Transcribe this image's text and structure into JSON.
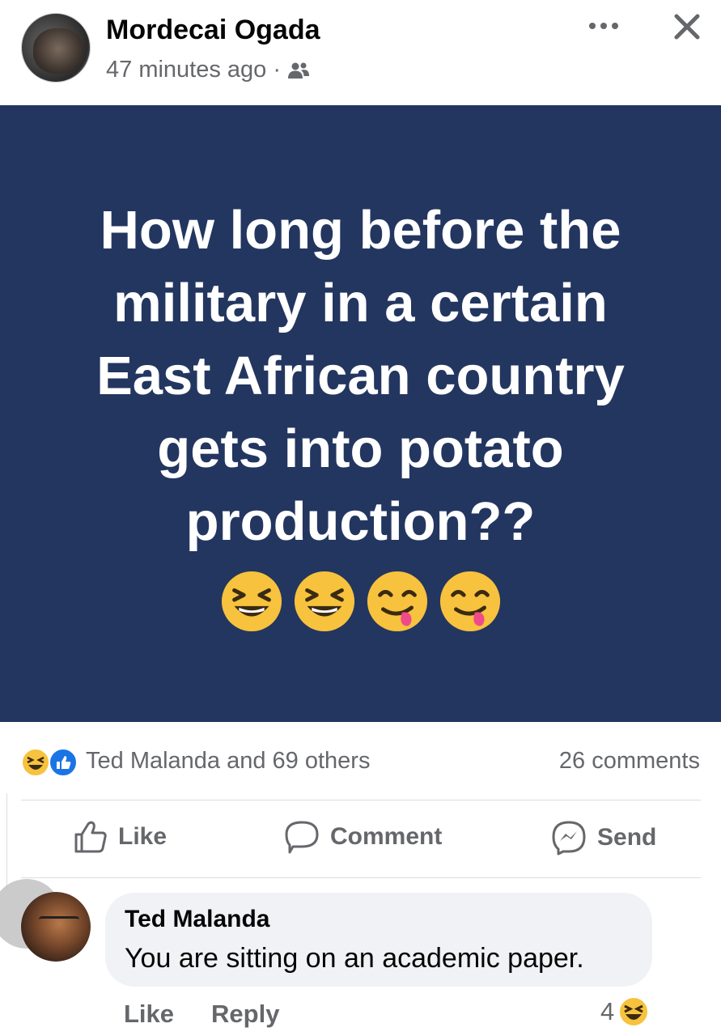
{
  "post": {
    "author": "Mordecai Ogada",
    "time": "47 minutes ago",
    "separator": "·",
    "audience_icon": "friends-icon",
    "menu_icon": "more-horizontal-icon",
    "close_icon": "close-icon",
    "text": "How long before the military in a certain East African country gets into potato production??",
    "emojis": [
      "laughing-face",
      "laughing-face",
      "face-savoring-food",
      "face-savoring-food"
    ],
    "background_color": "#233660"
  },
  "stats": {
    "reactions_label": "Ted Malanda and 69 others",
    "reaction_icons": [
      "haha-reaction-icon",
      "like-reaction-icon"
    ],
    "comments_label": "26 comments"
  },
  "actions": {
    "like": "Like",
    "comment": "Comment",
    "send": "Send"
  },
  "comment": {
    "author": "Ted Malanda",
    "text": "You are sitting on an academic paper.",
    "like": "Like",
    "reply": "Reply",
    "reaction_count": "4",
    "reaction_icon": "haha-reaction-icon"
  }
}
